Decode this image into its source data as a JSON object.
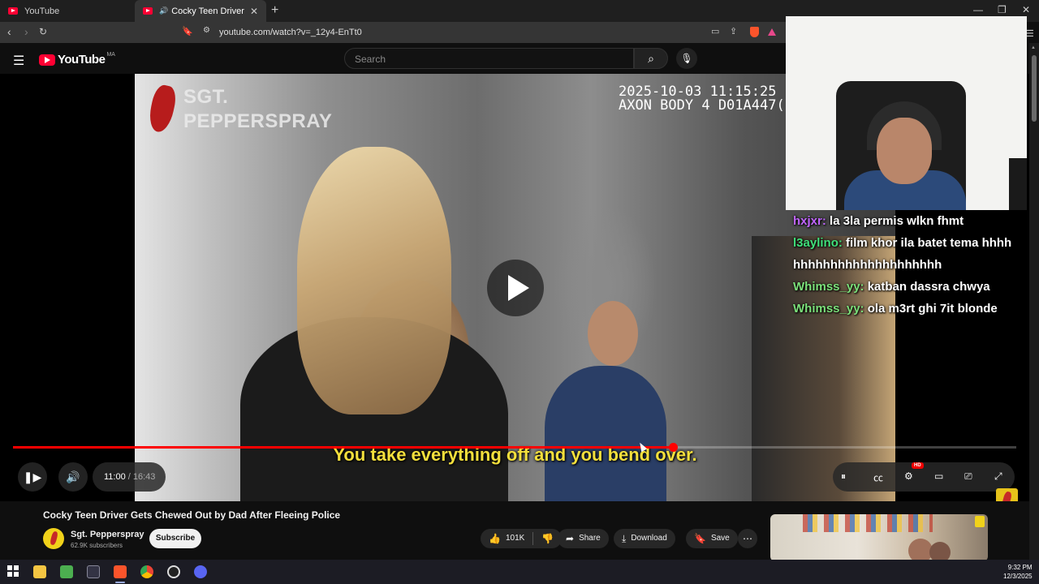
{
  "browser": {
    "tabs": [
      {
        "label": "YouTube"
      },
      {
        "label": "Cocky Teen Driver Gets Chewed"
      }
    ],
    "url": "youtube.com/watch?v=_12y4-EnTt0"
  },
  "youtube": {
    "logo": "YouTube",
    "country_code": "MA",
    "search_placeholder": "Search"
  },
  "player": {
    "watermark_line1": "SGT.",
    "watermark_line2": "PEPPERSPRAY",
    "bodycam_stamp": "2025-10-03 11:15:25\nAXON BODY 4 D01A447(",
    "caption": "You take everything off and you bend over.",
    "current_time": "11:00",
    "separator": " / ",
    "duration": "16:43",
    "progress_fraction": 0.658,
    "hd_badge": "HD"
  },
  "chat": [
    {
      "user": "hxjxr",
      "text": "la 3la permis wlkn fhmt"
    },
    {
      "user": "l3aylino",
      "text": "film khor ila batet tema hhhhhhhhhhhhhhhhhhhhhhhh"
    },
    {
      "user": "Whimss_yy",
      "text": "katban dassra chwya"
    },
    {
      "user": "Whimss_yy",
      "text": "ola m3rt ghi 7it blonde"
    }
  ],
  "video_info": {
    "title": "Cocky Teen Driver Gets Chewed Out by Dad After Fleeing Police",
    "channel": "Sgt. Pepperspray",
    "subscribers": "62.9K subscribers",
    "subscribe_label": "Subscribe",
    "likes": "101K",
    "share_label": "Share",
    "download_label": "Download",
    "save_label": "Save"
  },
  "taskbar": {
    "time": "9:32 PM",
    "date": "12/3/2025"
  },
  "colors": {
    "youtube_red": "#ff0033",
    "caption_yellow": "#f3df3c",
    "chat_user_purple": "#c065ff",
    "chat_user_green": "#3fe07a"
  }
}
